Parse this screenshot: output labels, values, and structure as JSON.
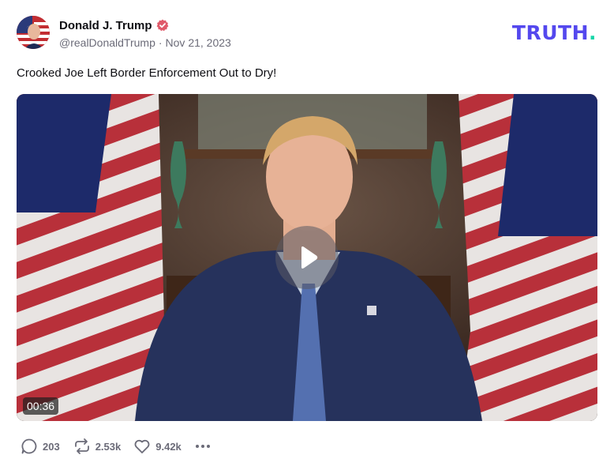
{
  "post": {
    "author": {
      "display_name": "Donald J. Trump",
      "handle": "@realDonaldTrump",
      "verified": true,
      "verified_color": "#e05a6a"
    },
    "separator": "·",
    "date": "Nov 21, 2023",
    "text": "Crooked Joe Left Border Enforcement Out to Dry!",
    "video": {
      "duration": "00:36",
      "icon": "play-icon"
    },
    "actions": {
      "replies": "203",
      "retruths": "2.53k",
      "likes": "9.42k",
      "more_icon": "more-icon"
    }
  },
  "brand": {
    "logo_text": "TRUTH",
    "logo_dot": ".",
    "logo_color": "#5448ee",
    "dot_color": "#17d6a8"
  }
}
